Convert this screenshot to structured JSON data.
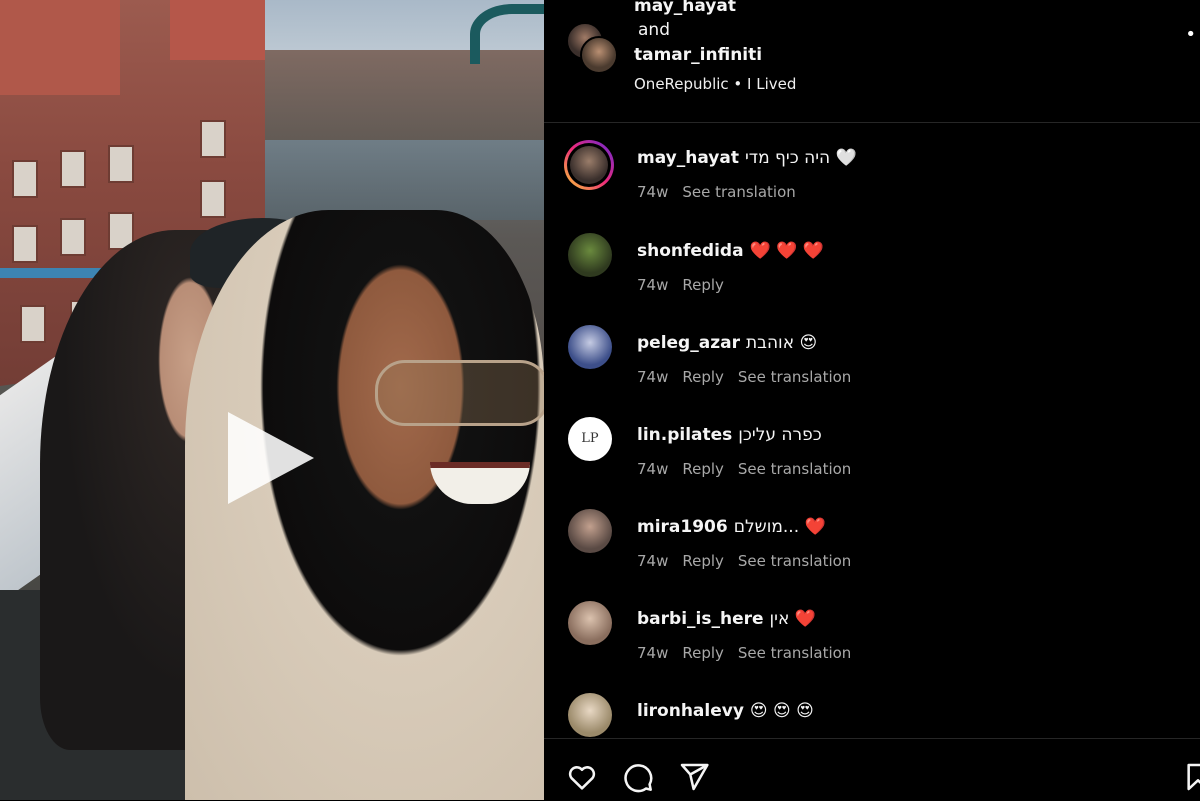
{
  "header": {
    "user1": "may_hayat",
    "and_text": "and",
    "user2": "tamar_infiniti",
    "music": "OneRepublic • I Lived"
  },
  "comments": [
    {
      "user": "may_hayat",
      "text": "היה כיף מדי 🤍",
      "time": "74w",
      "actions": [
        "See translation"
      ]
    },
    {
      "user": "shonfedida",
      "text": "❤️ ❤️ ❤️",
      "time": "74w",
      "actions": [
        "Reply"
      ]
    },
    {
      "user": "peleg_azar",
      "text": "אוהבת 😍",
      "time": "74w",
      "actions": [
        "Reply",
        "See translation"
      ]
    },
    {
      "user": "lin.pilates",
      "text": "כפרה עליכן",
      "time": "74w",
      "actions": [
        "Reply",
        "See translation"
      ]
    },
    {
      "user": "mira1906",
      "text": "מושלם... ❤️",
      "time": "74w",
      "actions": [
        "Reply",
        "See translation"
      ]
    },
    {
      "user": "barbi_is_here",
      "text": "אין ❤️",
      "time": "74w",
      "actions": [
        "Reply",
        "See translation"
      ]
    },
    {
      "user": "lironhalevy",
      "text": "😍 😍 😍",
      "time": "",
      "actions": []
    }
  ],
  "icons": {
    "like": "heart-icon",
    "comment": "comment-bubble-icon",
    "share": "paper-plane-icon",
    "save": "bookmark-icon",
    "more": "more-options-icon",
    "play": "play-icon"
  },
  "colors": {
    "background": "#000000",
    "text": "#f5f5f5",
    "secondary_text": "#a8a8a8",
    "divider": "#262626"
  }
}
